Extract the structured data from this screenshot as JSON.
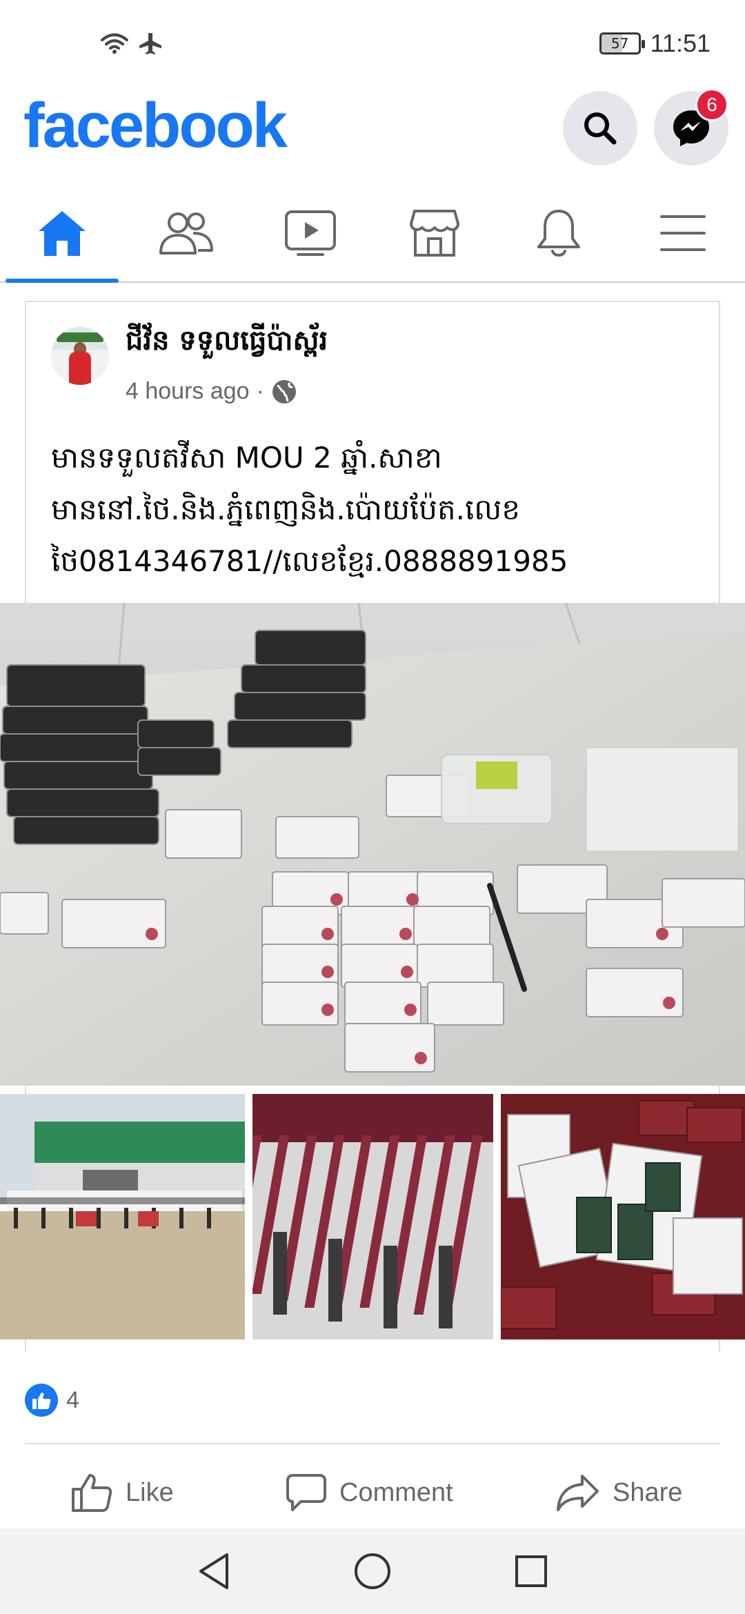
{
  "status_bar": {
    "battery_level": "57",
    "time": "11:51",
    "icons": [
      "wifi-icon",
      "airplane-icon"
    ]
  },
  "header": {
    "logo": "facebook",
    "messenger_badge": "6"
  },
  "nav": {
    "tabs": [
      "home",
      "friends",
      "watch",
      "marketplace",
      "notifications",
      "menu"
    ],
    "active": "home"
  },
  "post": {
    "author": "ជីវ័ន ទទួលធ្វើប៉ាស្ព័រ",
    "time": "4 hours ago",
    "separator": "·",
    "text_lines": [
      "មានទទួលតវីសា MOU 2 ឆ្នាំ.សាខា",
      "មាននៅ.ថៃ.និង.ភ្នំពេញនិង.ប៉ោយប៉ែត.លេខ",
      "ថៃ0814346781//លេខខ្មែរ.0888891985"
    ],
    "reactions_count": "4"
  },
  "actions": {
    "like": "Like",
    "comment": "Comment",
    "share": "Share"
  },
  "colors": {
    "brand": "#1877f2",
    "badge": "#e41e3f",
    "secondary_text": "#65676b"
  }
}
